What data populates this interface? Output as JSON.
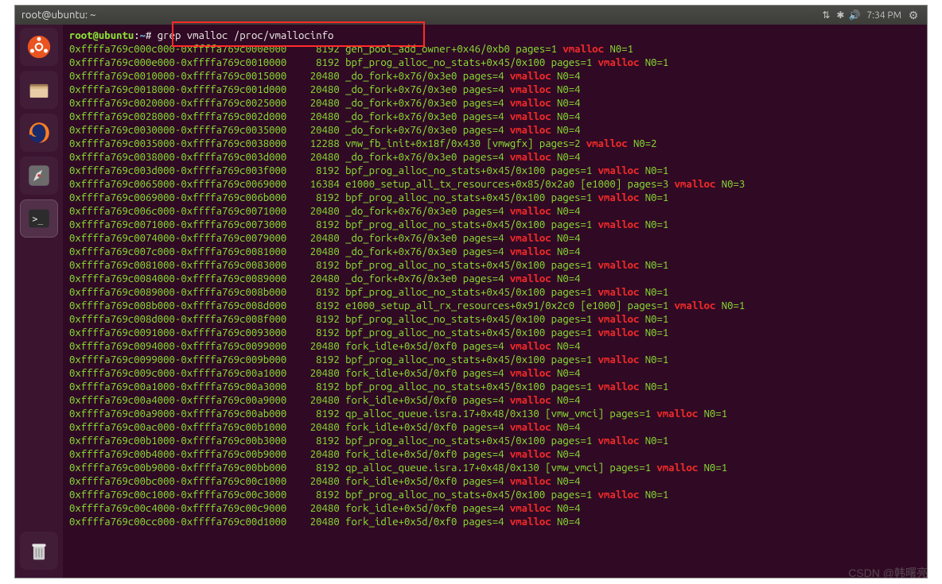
{
  "titlebar": {
    "title": "root@ubuntu: ~",
    "time": "7:34 PM"
  },
  "prompt": {
    "userhost": "root@ubuntu",
    "path": "~",
    "command": "grep vmalloc /proc/vmallocinfo"
  },
  "lines": [
    {
      "a": "0xffffa769c000c000-0xffffa769c000e000",
      "s": "8192",
      "f": "gen_pool_add_owner+0x46/0xb0",
      "p": "pages=1",
      "n": "N0=1"
    },
    {
      "a": "0xffffa769c000e000-0xffffa769c0010000",
      "s": "8192",
      "f": "bpf_prog_alloc_no_stats+0x45/0x100",
      "p": "pages=1",
      "n": "N0=1"
    },
    {
      "a": "0xffffa769c0010000-0xffffa769c0015000",
      "s": "20480",
      "f": "_do_fork+0x76/0x3e0",
      "p": "pages=4",
      "n": "N0=4"
    },
    {
      "a": "0xffffa769c0018000-0xffffa769c001d000",
      "s": "20480",
      "f": "_do_fork+0x76/0x3e0",
      "p": "pages=4",
      "n": "N0=4"
    },
    {
      "a": "0xffffa769c0020000-0xffffa769c0025000",
      "s": "20480",
      "f": "_do_fork+0x76/0x3e0",
      "p": "pages=4",
      "n": "N0=4"
    },
    {
      "a": "0xffffa769c0028000-0xffffa769c002d000",
      "s": "20480",
      "f": "_do_fork+0x76/0x3e0",
      "p": "pages=4",
      "n": "N0=4"
    },
    {
      "a": "0xffffa769c0030000-0xffffa769c0035000",
      "s": "20480",
      "f": "_do_fork+0x76/0x3e0",
      "p": "pages=4",
      "n": "N0=4"
    },
    {
      "a": "0xffffa769c0035000-0xffffa769c0038000",
      "s": "12288",
      "f": "vmw_fb_init+0x18f/0x430 [vmwgfx]",
      "p": "pages=2",
      "n": "N0=2"
    },
    {
      "a": "0xffffa769c0038000-0xffffa769c003d000",
      "s": "20480",
      "f": "_do_fork+0x76/0x3e0",
      "p": "pages=4",
      "n": "N0=4"
    },
    {
      "a": "0xffffa769c003d000-0xffffa769c003f000",
      "s": "8192",
      "f": "bpf_prog_alloc_no_stats+0x45/0x100",
      "p": "pages=1",
      "n": "N0=1"
    },
    {
      "a": "0xffffa769c0065000-0xffffa769c0069000",
      "s": "16384",
      "f": "e1000_setup_all_tx_resources+0x85/0x2a0 [e1000]",
      "p": "pages=3",
      "n": "N0=3"
    },
    {
      "a": "0xffffa769c0069000-0xffffa769c006b000",
      "s": "8192",
      "f": "bpf_prog_alloc_no_stats+0x45/0x100",
      "p": "pages=1",
      "n": "N0=1"
    },
    {
      "a": "0xffffa769c006c000-0xffffa769c0071000",
      "s": "20480",
      "f": "_do_fork+0x76/0x3e0",
      "p": "pages=4",
      "n": "N0=4"
    },
    {
      "a": "0xffffa769c0071000-0xffffa769c0073000",
      "s": "8192",
      "f": "bpf_prog_alloc_no_stats+0x45/0x100",
      "p": "pages=1",
      "n": "N0=1"
    },
    {
      "a": "0xffffa769c0074000-0xffffa769c0079000",
      "s": "20480",
      "f": "_do_fork+0x76/0x3e0",
      "p": "pages=4",
      "n": "N0=4"
    },
    {
      "a": "0xffffa769c007c000-0xffffa769c0081000",
      "s": "20480",
      "f": "_do_fork+0x76/0x3e0",
      "p": "pages=4",
      "n": "N0=4"
    },
    {
      "a": "0xffffa769c0081000-0xffffa769c0083000",
      "s": "8192",
      "f": "bpf_prog_alloc_no_stats+0x45/0x100",
      "p": "pages=1",
      "n": "N0=1"
    },
    {
      "a": "0xffffa769c0084000-0xffffa769c0089000",
      "s": "20480",
      "f": "_do_fork+0x76/0x3e0",
      "p": "pages=4",
      "n": "N0=4"
    },
    {
      "a": "0xffffa769c0089000-0xffffa769c008b000",
      "s": "8192",
      "f": "bpf_prog_alloc_no_stats+0x45/0x100",
      "p": "pages=1",
      "n": "N0=1"
    },
    {
      "a": "0xffffa769c008b000-0xffffa769c008d000",
      "s": "8192",
      "f": "e1000_setup_all_rx_resources+0x91/0x2c0 [e1000]",
      "p": "pages=1",
      "n": "N0=1"
    },
    {
      "a": "0xffffa769c008d000-0xffffa769c008f000",
      "s": "8192",
      "f": "bpf_prog_alloc_no_stats+0x45/0x100",
      "p": "pages=1",
      "n": "N0=1"
    },
    {
      "a": "0xffffa769c0091000-0xffffa769c0093000",
      "s": "8192",
      "f": "bpf_prog_alloc_no_stats+0x45/0x100",
      "p": "pages=1",
      "n": "N0=1"
    },
    {
      "a": "0xffffa769c0094000-0xffffa769c0099000",
      "s": "20480",
      "f": "fork_idle+0x5d/0xf0",
      "p": "pages=4",
      "n": "N0=4"
    },
    {
      "a": "0xffffa769c0099000-0xffffa769c009b000",
      "s": "8192",
      "f": "bpf_prog_alloc_no_stats+0x45/0x100",
      "p": "pages=1",
      "n": "N0=1"
    },
    {
      "a": "0xffffa769c009c000-0xffffa769c00a1000",
      "s": "20480",
      "f": "fork_idle+0x5d/0xf0",
      "p": "pages=4",
      "n": "N0=4"
    },
    {
      "a": "0xffffa769c00a1000-0xffffa769c00a3000",
      "s": "8192",
      "f": "bpf_prog_alloc_no_stats+0x45/0x100",
      "p": "pages=1",
      "n": "N0=1"
    },
    {
      "a": "0xffffa769c00a4000-0xffffa769c00a9000",
      "s": "20480",
      "f": "fork_idle+0x5d/0xf0",
      "p": "pages=4",
      "n": "N0=4"
    },
    {
      "a": "0xffffa769c00a9000-0xffffa769c00ab000",
      "s": "8192",
      "f": "qp_alloc_queue.isra.17+0x48/0x130 [vmw_vmci]",
      "p": "pages=1",
      "n": "N0=1"
    },
    {
      "a": "0xffffa769c00ac000-0xffffa769c00b1000",
      "s": "20480",
      "f": "fork_idle+0x5d/0xf0",
      "p": "pages=4",
      "n": "N0=4"
    },
    {
      "a": "0xffffa769c00b1000-0xffffa769c00b3000",
      "s": "8192",
      "f": "bpf_prog_alloc_no_stats+0x45/0x100",
      "p": "pages=1",
      "n": "N0=1"
    },
    {
      "a": "0xffffa769c00b4000-0xffffa769c00b9000",
      "s": "20480",
      "f": "fork_idle+0x5d/0xf0",
      "p": "pages=4",
      "n": "N0=4"
    },
    {
      "a": "0xffffa769c00b9000-0xffffa769c00bb000",
      "s": "8192",
      "f": "qp_alloc_queue.isra.17+0x48/0x130 [vmw_vmci]",
      "p": "pages=1",
      "n": "N0=1"
    },
    {
      "a": "0xffffa769c00bc000-0xffffa769c00c1000",
      "s": "20480",
      "f": "fork_idle+0x5d/0xf0",
      "p": "pages=4",
      "n": "N0=4"
    },
    {
      "a": "0xffffa769c00c1000-0xffffa769c00c3000",
      "s": "8192",
      "f": "bpf_prog_alloc_no_stats+0x45/0x100",
      "p": "pages=1",
      "n": "N0=1"
    },
    {
      "a": "0xffffa769c00c4000-0xffffa769c00c9000",
      "s": "20480",
      "f": "fork_idle+0x5d/0xf0",
      "p": "pages=4",
      "n": "N0=4"
    },
    {
      "a": "0xffffa769c00cc000-0xffffa769c00d1000",
      "s": "20480",
      "f": "fork_idle+0x5d/0xf0",
      "p": "pages=4",
      "n": "N0=4"
    }
  ],
  "highlight_word": "vmalloc",
  "watermark": "CSDN @韩曙亮"
}
